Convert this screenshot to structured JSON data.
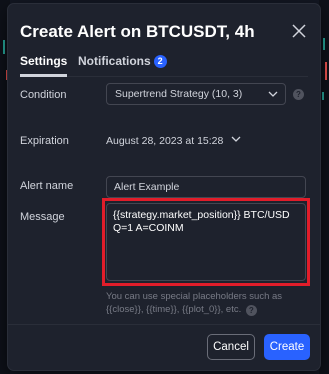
{
  "dialog": {
    "title": "Create Alert on BTCUSDT, 4h",
    "close_icon": "close-icon"
  },
  "tabs": [
    {
      "label": "Settings",
      "active": true
    },
    {
      "label": "Notifications",
      "badge": "2"
    }
  ],
  "form": {
    "condition": {
      "label": "Condition",
      "value": "Supertrend Strategy (10, 3)"
    },
    "expiration": {
      "label": "Expiration",
      "value": "August 28, 2023 at 15:28"
    },
    "alert_name": {
      "label": "Alert name",
      "value": "Alert Example"
    },
    "message": {
      "label": "Message",
      "value": "{{strategy.market_position}} BTC/USD Q=1 A=COINM",
      "hint": "You can use special placeholders such as {{close}}, {{time}}, {{plot_0}}, etc."
    }
  },
  "buttons": {
    "cancel": "Cancel",
    "create": "Create"
  },
  "colors": {
    "accent": "#2962ff",
    "dialog_bg": "#1e222d",
    "highlight": "#e11d2a"
  }
}
